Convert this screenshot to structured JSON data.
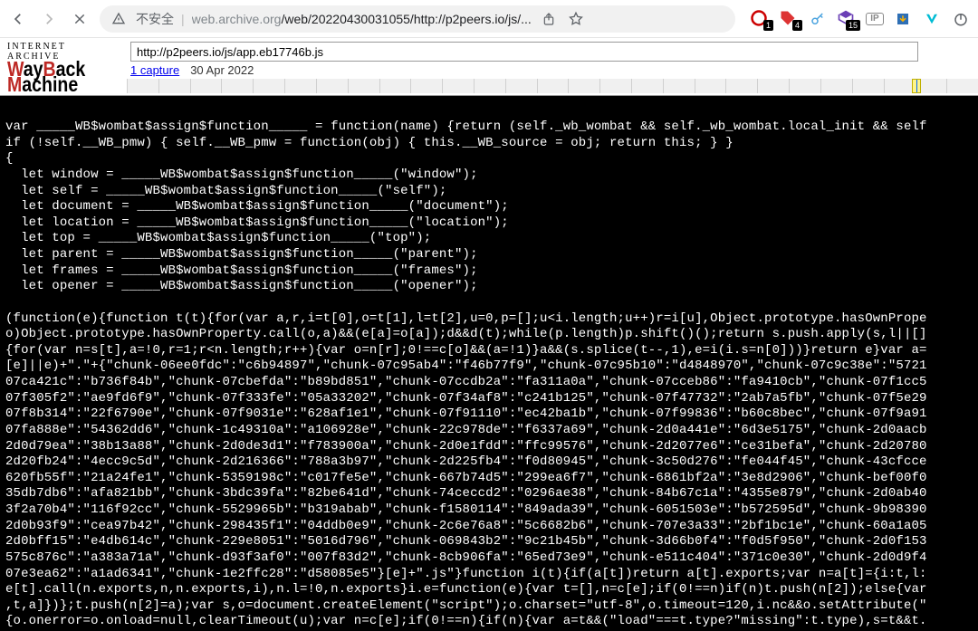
{
  "toolbar": {
    "not_safe_label": "不安全",
    "url_dim": "web.archive.org",
    "url_rest": "/web/20220430031055/http://p2peers.io/js/...",
    "badge1": "1",
    "badge4": "4",
    "badge15": "15"
  },
  "wayback": {
    "logo_top": "INTERNET ARCHIVE",
    "url_input": "http://p2peers.io/js/app.eb17746b.js",
    "captures": "1 capture",
    "date": "30 Apr 2022"
  },
  "code": "var _____WB$wombat$assign$function_____ = function(name) {return (self._wb_wombat && self._wb_wombat.local_init && self\nif (!self.__WB_pmw) { self.__WB_pmw = function(obj) { this.__WB_source = obj; return this; } }\n{\n  let window = _____WB$wombat$assign$function_____(\"window\");\n  let self = _____WB$wombat$assign$function_____(\"self\");\n  let document = _____WB$wombat$assign$function_____(\"document\");\n  let location = _____WB$wombat$assign$function_____(\"location\");\n  let top = _____WB$wombat$assign$function_____(\"top\");\n  let parent = _____WB$wombat$assign$function_____(\"parent\");\n  let frames = _____WB$wombat$assign$function_____(\"frames\");\n  let opener = _____WB$wombat$assign$function_____(\"opener\");\n\n(function(e){function t(t){for(var a,r,i=t[0],o=t[1],l=t[2],u=0,p=[];u<i.length;u++)r=i[u],Object.prototype.hasOwnPrope\no)Object.prototype.hasOwnProperty.call(o,a)&&(e[a]=o[a]);d&&d(t);while(p.length)p.shift()();return s.push.apply(s,l||[]\n{for(var n=s[t],a=!0,r=1;r<n.length;r++){var o=n[r];0!==c[o]&&(a=!1)}a&&(s.splice(t--,1),e=i(i.s=n[0]))}return e}var a=\n[e]||e)+\".\"+{\"chunk-06ee0fdc\":\"c6b94897\",\"chunk-07c95ab4\":\"f46b77f9\",\"chunk-07c95b10\":\"d4848970\",\"chunk-07c9c38e\":\"5721\n07ca421c\":\"b736f84b\",\"chunk-07cbefda\":\"b89bd851\",\"chunk-07ccdb2a\":\"fa311a0a\",\"chunk-07cceb86\":\"fa9410cb\",\"chunk-07f1cc5\n07f305f2\":\"ae9fd6f9\",\"chunk-07f333fe\":\"05a33202\",\"chunk-07f34af8\":\"c241b125\",\"chunk-07f47732\":\"2ab7a5fb\",\"chunk-07f5e29\n07f8b314\":\"22f6790e\",\"chunk-07f9031e\":\"628af1e1\",\"chunk-07f91110\":\"ec42ba1b\",\"chunk-07f99836\":\"b60c8bec\",\"chunk-07f9a91\n07fa888e\":\"54362dd6\",\"chunk-1c49310a\":\"a106928e\",\"chunk-22c978de\":\"f6337a69\",\"chunk-2d0a441e\":\"6d3e5175\",\"chunk-2d0aacb\n2d0d79ea\":\"38b13a88\",\"chunk-2d0de3d1\":\"f783900a\",\"chunk-2d0e1fdd\":\"ffc99576\",\"chunk-2d2077e6\":\"ce31befa\",\"chunk-2d20780\n2d20fb24\":\"4ecc9c5d\",\"chunk-2d216366\":\"788a3b97\",\"chunk-2d225fb4\":\"f0d80945\",\"chunk-3c50d276\":\"fe044f45\",\"chunk-43cfcce\n620fb55f\":\"21a24fe1\",\"chunk-5359198c\":\"c017fe5e\",\"chunk-667b74d5\":\"299ea6f7\",\"chunk-6861bf2a\":\"3e8d2906\",\"chunk-bef00f0\n35db7db6\":\"afa821bb\",\"chunk-3bdc39fa\":\"82be641d\",\"chunk-74ceccd2\":\"0296ae38\",\"chunk-84b67c1a\":\"4355e879\",\"chunk-2d0ab40\n3f2a70b4\":\"116f92cc\",\"chunk-5529965b\":\"b319abab\",\"chunk-f1580114\":\"849ada39\",\"chunk-6051503e\":\"b572595d\",\"chunk-9b98390\n2d0b93f9\":\"cea97b42\",\"chunk-298435f1\":\"04ddb0e9\",\"chunk-2c6e76a8\":\"5c6682b6\",\"chunk-707e3a33\":\"2bf1bc1e\",\"chunk-60a1a05\n2d0bff15\":\"e4db614c\",\"chunk-229e8051\":\"5016d796\",\"chunk-069843b2\":\"9c21b45b\",\"chunk-3d66b0f4\":\"f0d5f950\",\"chunk-2d0f153\n575c876c\":\"a383a71a\",\"chunk-d93f3af0\":\"007f83d2\",\"chunk-8cb906fa\":\"65ed73e9\",\"chunk-e511c404\":\"371c0e30\",\"chunk-2d0d9f4\n07e3ea62\":\"a1ad6341\",\"chunk-1e2ffc28\":\"d58085e5\"}[e]+\".js\"}function i(t){if(a[t])return a[t].exports;var n=a[t]={i:t,l:\ne[t].call(n.exports,n,n.exports,i),n.l=!0,n.exports}i.e=function(e){var t=[],n=c[e];if(0!==n)if(n)t.push(n[2]);else{var\n,t,a]})};t.push(n[2]=a);var s,o=document.createElement(\"script\");o.charset=\"utf-8\",o.timeout=120,i.nc&&o.setAttribute(\"\n{o.onerror=o.onload=null,clearTimeout(u);var n=c[e];if(0!==n){if(n){var a=t&&(\"load\"===t.type?\"missing\":t.type),s=t&&t."
}
